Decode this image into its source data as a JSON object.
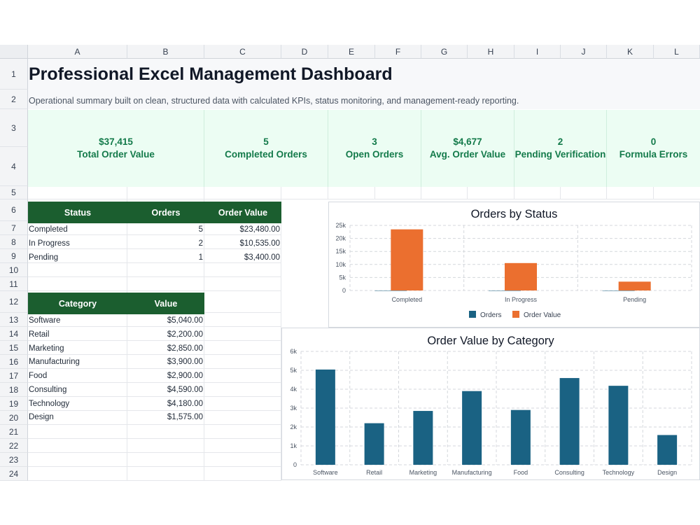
{
  "columns": [
    "A",
    "B",
    "C",
    "D",
    "E",
    "F",
    "G",
    "H",
    "I",
    "J",
    "K",
    "L"
  ],
  "rows": [
    "1",
    "2",
    "3",
    "4",
    "5",
    "6",
    "7",
    "8",
    "9",
    "10",
    "11",
    "12",
    "13",
    "14",
    "15",
    "16",
    "17",
    "18",
    "19",
    "20",
    "21",
    "22",
    "23",
    "24"
  ],
  "header": {
    "title": "Professional Excel Management Dashboard",
    "subtitle": "Operational summary built on clean, structured data with calculated KPIs, status monitoring, and management-ready reporting."
  },
  "kpis": [
    {
      "value": "$37,415",
      "label": "Total Order Value"
    },
    {
      "value": "5",
      "label": "Completed Orders"
    },
    {
      "value": "3",
      "label": "Open Orders"
    },
    {
      "value": "$4,677",
      "label": "Avg. Order Value"
    },
    {
      "value": "2",
      "label": "Pending Verification"
    },
    {
      "value": "0",
      "label": "Formula Errors"
    }
  ],
  "status_table": {
    "headers": [
      "Status",
      "Orders",
      "Order Value"
    ],
    "rows": [
      {
        "status": "Completed",
        "orders": "5",
        "value": "$23,480.00"
      },
      {
        "status": "In Progress",
        "orders": "2",
        "value": "$10,535.00"
      },
      {
        "status": "Pending",
        "orders": "1",
        "value": "$3,400.00"
      }
    ]
  },
  "category_table": {
    "headers": [
      "Category",
      "Value"
    ],
    "rows": [
      {
        "category": "Software",
        "value": "$5,040.00"
      },
      {
        "category": "Retail",
        "value": "$2,200.00"
      },
      {
        "category": "Marketing",
        "value": "$2,850.00"
      },
      {
        "category": "Manufacturing",
        "value": "$3,900.00"
      },
      {
        "category": "Food",
        "value": "$2,900.00"
      },
      {
        "category": "Consulting",
        "value": "$4,590.00"
      },
      {
        "category": "Technology",
        "value": "$4,180.00"
      },
      {
        "category": "Design",
        "value": "$1,575.00"
      }
    ]
  },
  "colors": {
    "orders": "#1a6283",
    "order_value": "#eb6f2f",
    "category_bar": "#1a6283",
    "table_header": "#1b5e2f",
    "kpi_text": "#137a4a",
    "kpi_background": "#ecfdf3"
  },
  "chart_data": [
    {
      "type": "bar",
      "title": "Orders by Status",
      "categories": [
        "Completed",
        "In Progress",
        "Pending"
      ],
      "series": [
        {
          "name": "Orders",
          "values": [
            5,
            2,
            1
          ]
        },
        {
          "name": "Order Value",
          "values": [
            23480,
            10535,
            3400
          ]
        }
      ],
      "yticks": [
        "0",
        "5k",
        "10k",
        "15k",
        "20k",
        "25k"
      ],
      "ylim": [
        0,
        25000
      ],
      "grid": true,
      "legend": "bottom"
    },
    {
      "type": "bar",
      "title": "Order Value by Category",
      "categories": [
        "Software",
        "Retail",
        "Marketing",
        "Manufacturing",
        "Food",
        "Consulting",
        "Technology",
        "Design"
      ],
      "values": [
        5040,
        2200,
        2850,
        3900,
        2900,
        4590,
        4180,
        1575
      ],
      "yticks": [
        "0",
        "1k",
        "2k",
        "3k",
        "4k",
        "5k",
        "6k"
      ],
      "ylim": [
        0,
        6000
      ],
      "grid": true,
      "legend": "none"
    }
  ]
}
